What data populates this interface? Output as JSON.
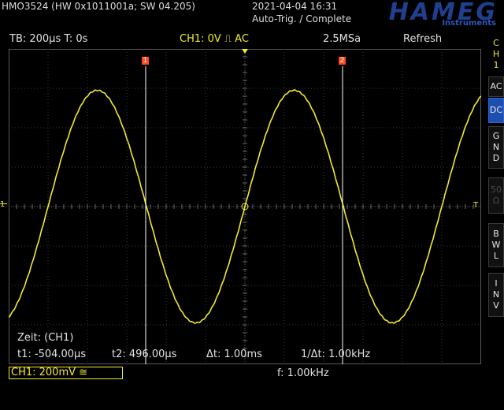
{
  "header": {
    "device_info": "HMO3524 (HW 0x1011001a; SW 04.205)",
    "datetime": "2021-04-04 16:31",
    "status": "Auto-Trig. / Complete",
    "logo": "HAMEG",
    "logo_sub": "Instruments"
  },
  "statusbar": {
    "timebase": "TB: 200µs  T: 0s",
    "channel_trigger": "CH1: 0V ⎍ AC",
    "sample_rate": "2.5MSa",
    "mode": "Refresh"
  },
  "side_menu": {
    "channel_label": [
      "C",
      "H",
      "1"
    ],
    "buttons": [
      {
        "label": "AC",
        "state": "normal"
      },
      {
        "label": "DC",
        "state": "active"
      },
      {
        "label": "G\nN\nD",
        "state": "normal"
      },
      {
        "label": "50\nΩ",
        "state": "disabled"
      },
      {
        "label": "B\nW\nL",
        "state": "normal"
      },
      {
        "label": "I\nN\nV",
        "state": "normal"
      }
    ]
  },
  "cursors": {
    "c1_label": "1",
    "c2_label": "2",
    "source": "Zeit: (CH1)",
    "t1": "t1: -504.00µs",
    "t2": "t2: 496.00µs",
    "dt": "Δt: 1.00ms",
    "inv_dt": "1/Δt: 1.00kHz"
  },
  "markers": {
    "ch1_ground": "1",
    "trigger_level": "T"
  },
  "bottom": {
    "channel_setting": "CH1: 200mV ≅",
    "frequency": "f: 1.00kHz"
  },
  "colors": {
    "trace": "#f2ea2a",
    "grid": "#3a3a3a",
    "cursor": "#ffffff",
    "cursor_label": "#ff4a1a",
    "active_button": "#1d4fae"
  },
  "chart_data": {
    "type": "line",
    "signal": "sine",
    "timebase_per_div_us": 200,
    "volts_per_div_mV": 200,
    "frequency_kHz": 1.0,
    "amplitude_div": 2.95,
    "x_range_us": [
      -1200,
      1200
    ],
    "y_range_div": [
      -4,
      4
    ],
    "cursor_t1_us": -504,
    "cursor_t2_us": 496
  }
}
